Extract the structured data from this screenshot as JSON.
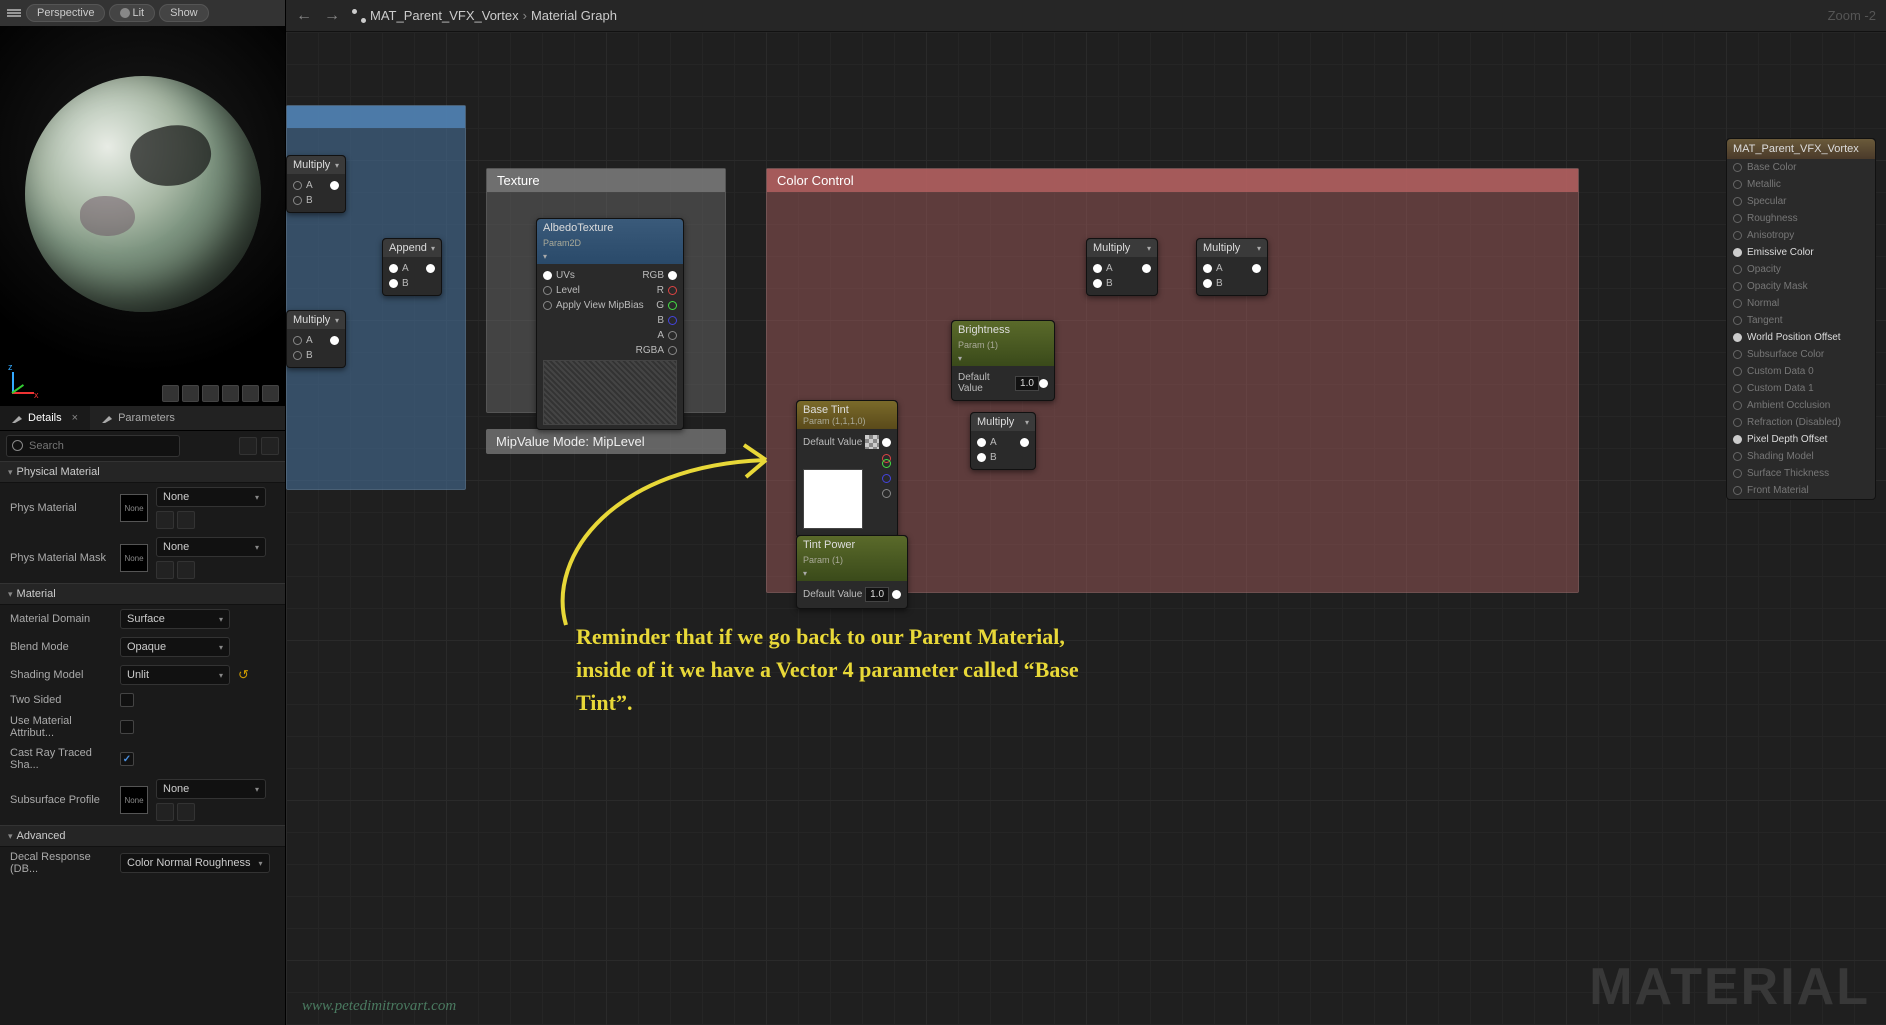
{
  "viewport": {
    "perspective": "Perspective",
    "lit": "Lit",
    "show": "Show"
  },
  "tabs": {
    "details": "Details",
    "parameters": "Parameters"
  },
  "search": {
    "placeholder": "Search"
  },
  "sections": {
    "physical": "Physical Material",
    "material": "Material",
    "advanced": "Advanced"
  },
  "props": {
    "phys_material": {
      "label": "Phys Material",
      "value": "None",
      "thumb": "None"
    },
    "phys_mask": {
      "label": "Phys Material Mask",
      "value": "None",
      "thumb": "None"
    },
    "domain": {
      "label": "Material Domain",
      "value": "Surface"
    },
    "blend": {
      "label": "Blend Mode",
      "value": "Opaque"
    },
    "shading": {
      "label": "Shading Model",
      "value": "Unlit"
    },
    "two_sided": {
      "label": "Two Sided"
    },
    "use_attr": {
      "label": "Use Material Attribut..."
    },
    "cast_ray": {
      "label": "Cast Ray Traced Sha..."
    },
    "subsurface": {
      "label": "Subsurface Profile",
      "value": "None",
      "thumb": "None"
    },
    "decal": {
      "label": "Decal Response (DB...",
      "value": "Color Normal Roughness"
    }
  },
  "topbar": {
    "asset": "MAT_Parent_VFX_Vortex",
    "page": "Material Graph",
    "zoom": "Zoom -2"
  },
  "comments": {
    "texture": "Texture",
    "color": "Color Control",
    "mip": "MipValue Mode: MipLevel"
  },
  "nodes": {
    "multiply": "Multiply",
    "append": "Append",
    "albedo": {
      "title": "AlbedoTexture",
      "sub": "Param2D",
      "uvs": "UVs",
      "level": "Level",
      "bias": "Apply View MipBias",
      "rgb": "RGB",
      "r": "R",
      "g": "G",
      "b": "B",
      "a": "A",
      "rgba": "RGBA"
    },
    "brightness": {
      "title": "Brightness",
      "sub": "Param (1)",
      "default": "Default Value",
      "val": "1.0"
    },
    "basetint": {
      "title": "Base Tint",
      "sub": "Param (1,1,1,0)",
      "default": "Default Value"
    },
    "tintpower": {
      "title": "Tint Power",
      "sub": "Param (1)",
      "default": "Default Value",
      "val": "1.0"
    },
    "inputA": "A",
    "inputB": "B"
  },
  "output": {
    "title": "MAT_Parent_VFX_Vortex",
    "pins": [
      "Base Color",
      "Metallic",
      "Specular",
      "Roughness",
      "Anisotropy",
      "Emissive Color",
      "Opacity",
      "Opacity Mask",
      "Normal",
      "Tangent",
      "World Position Offset",
      "Subsurface Color",
      "Custom Data 0",
      "Custom Data 1",
      "Ambient Occlusion",
      "Refraction (Disabled)",
      "Pixel Depth Offset",
      "Shading Model",
      "Surface Thickness",
      "Front Material"
    ],
    "active": [
      5,
      10,
      16
    ]
  },
  "annotation": "Reminder that if we go back to our Parent Material, inside of it we have a Vector 4 parameter called “Base Tint”.",
  "watermark": "MATERIAL",
  "credit": "www.petedimitrovart.com"
}
